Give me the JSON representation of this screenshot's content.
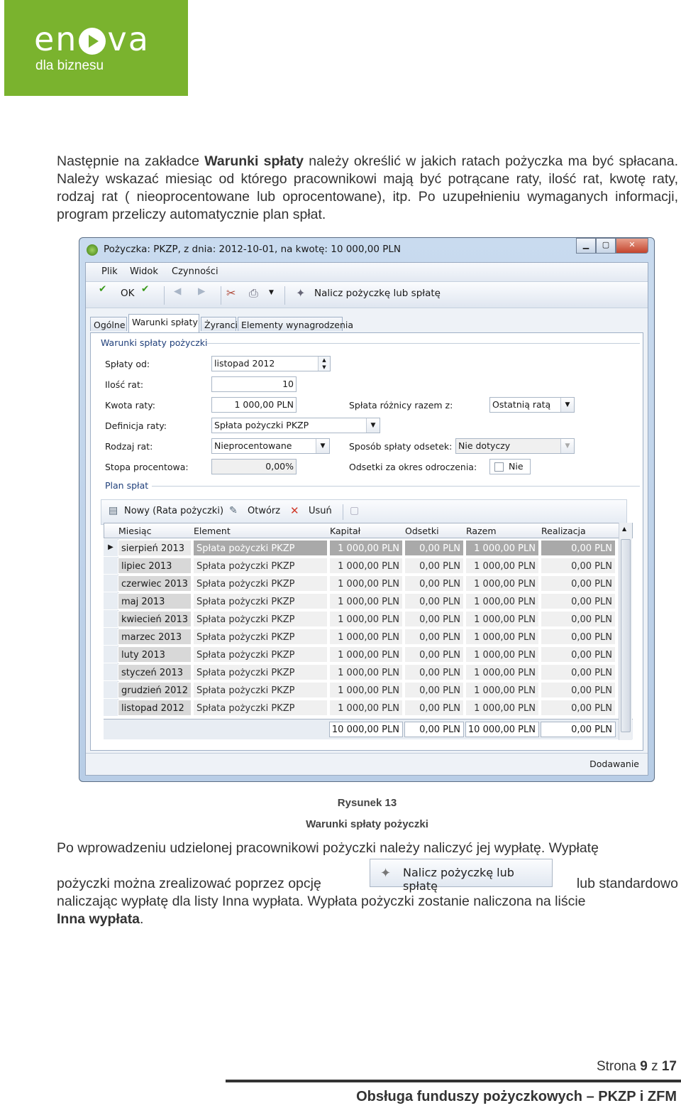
{
  "logo": {
    "brand": "en va",
    "brand_a": "en",
    "brand_b": "va",
    "tagline": "dla biznesu"
  },
  "intro": {
    "p1": "Następnie na zakładce ",
    "p1_bold": "Warunki spłaty",
    "p1_rest": " należy określić w jakich ratach pożyczka ma być spłacana. Należy wskazać miesiąc od którego pracownikowi mają być potrącane raty, ilość rat, kwotę raty, rodzaj rat ( nieoprocentowane lub oprocentowane), itp. Po uzupełnieniu wymaganych informacji, program przeliczy automatycznie plan spłat."
  },
  "window": {
    "title": "Pożyczka: PKZP, z dnia: 2012-10-01, na kwotę: 10 000,00 PLN",
    "menu": [
      "Plik",
      "Widok",
      "Czynności"
    ],
    "toolbar": {
      "ok": "OK",
      "action": "Nalicz pożyczkę lub spłatę"
    },
    "tabs": [
      "Ogólne",
      "Warunki spłaty",
      "Żyranci",
      "Elementy wynagrodzenia"
    ],
    "group1": "Warunki spłaty pożyczki",
    "fields": {
      "splaty_od_label": "Spłaty od:",
      "splaty_od": "listopad 2012",
      "ilosc_rat_label": "Ilość rat:",
      "ilosc_rat": "10",
      "kwota_raty_label": "Kwota raty:",
      "kwota_raty": "1 000,00 PLN",
      "definicja_label": "Definicja raty:",
      "definicja": "Spłata pożyczki PKZP",
      "rodzaj_label": "Rodzaj rat:",
      "rodzaj": "Nieprocentowane",
      "stopa_label": "Stopa procentowa:",
      "stopa": "0,00%",
      "roznica_label": "Spłata różnicy razem z:",
      "roznica": "Ostatnią ratą",
      "sposob_label": "Sposób spłaty odsetek:",
      "sposob": "Nie dotyczy",
      "odsetki_label": "Odsetki za okres odroczenia:",
      "odsetki": "Nie"
    },
    "group2": "Plan spłat",
    "grid_toolbar": {
      "new": "Nowy (Rata pożyczki)",
      "open": "Otwórz",
      "delete": "Usuń"
    },
    "columns": [
      "Miesiąc",
      "Element",
      "Kapitał",
      "Odsetki",
      "Razem",
      "Realizacja"
    ],
    "rows": [
      [
        "sierpień 2013",
        "Spłata pożyczki PKZP",
        "1 000,00 PLN",
        "0,00 PLN",
        "1 000,00 PLN",
        "0,00 PLN"
      ],
      [
        "lipiec 2013",
        "Spłata pożyczki PKZP",
        "1 000,00 PLN",
        "0,00 PLN",
        "1 000,00 PLN",
        "0,00 PLN"
      ],
      [
        "czerwiec 2013",
        "Spłata pożyczki PKZP",
        "1 000,00 PLN",
        "0,00 PLN",
        "1 000,00 PLN",
        "0,00 PLN"
      ],
      [
        "maj 2013",
        "Spłata pożyczki PKZP",
        "1 000,00 PLN",
        "0,00 PLN",
        "1 000,00 PLN",
        "0,00 PLN"
      ],
      [
        "kwiecień 2013",
        "Spłata pożyczki PKZP",
        "1 000,00 PLN",
        "0,00 PLN",
        "1 000,00 PLN",
        "0,00 PLN"
      ],
      [
        "marzec 2013",
        "Spłata pożyczki PKZP",
        "1 000,00 PLN",
        "0,00 PLN",
        "1 000,00 PLN",
        "0,00 PLN"
      ],
      [
        "luty 2013",
        "Spłata pożyczki PKZP",
        "1 000,00 PLN",
        "0,00 PLN",
        "1 000,00 PLN",
        "0,00 PLN"
      ],
      [
        "styczeń 2013",
        "Spłata pożyczki PKZP",
        "1 000,00 PLN",
        "0,00 PLN",
        "1 000,00 PLN",
        "0,00 PLN"
      ],
      [
        "grudzień 2012",
        "Spłata pożyczki PKZP",
        "1 000,00 PLN",
        "0,00 PLN",
        "1 000,00 PLN",
        "0,00 PLN"
      ],
      [
        "listopad 2012",
        "Spłata pożyczki PKZP",
        "1 000,00 PLN",
        "0,00 PLN",
        "1 000,00 PLN",
        "0,00 PLN"
      ]
    ],
    "totals": [
      "10 000,00 PLN",
      "0,00 PLN",
      "10 000,00 PLN",
      "0,00 PLN"
    ],
    "status": "Dodawanie"
  },
  "caption": {
    "line1": "Rysunek 13",
    "line2": "Warunki spłaty pożyczki"
  },
  "outro": {
    "line1": "Po wprowadzeniu udzielonej pracownikowi pożyczki należy naliczyć jej wypłatę. Wypłatę",
    "line2a": "pożyczki można zrealizować poprzez opcję",
    "line2b": "lub standardowo",
    "line3": "naliczając wypłatę dla listy Inna wypłata. Wypłata pożyczki zostanie naliczona na liście",
    "line4_bold": "Inna wypłata",
    "line4_rest": ".",
    "button": "Nalicz pożyczkę lub spłatę"
  },
  "footer": {
    "page_prefix": "Strona ",
    "page": "9",
    "page_mid": " z ",
    "total": "17",
    "title": "Obsługa funduszy pożyczkowych – PKZP i ZFM"
  },
  "colors": {
    "brand_green": "#7ab32e"
  }
}
